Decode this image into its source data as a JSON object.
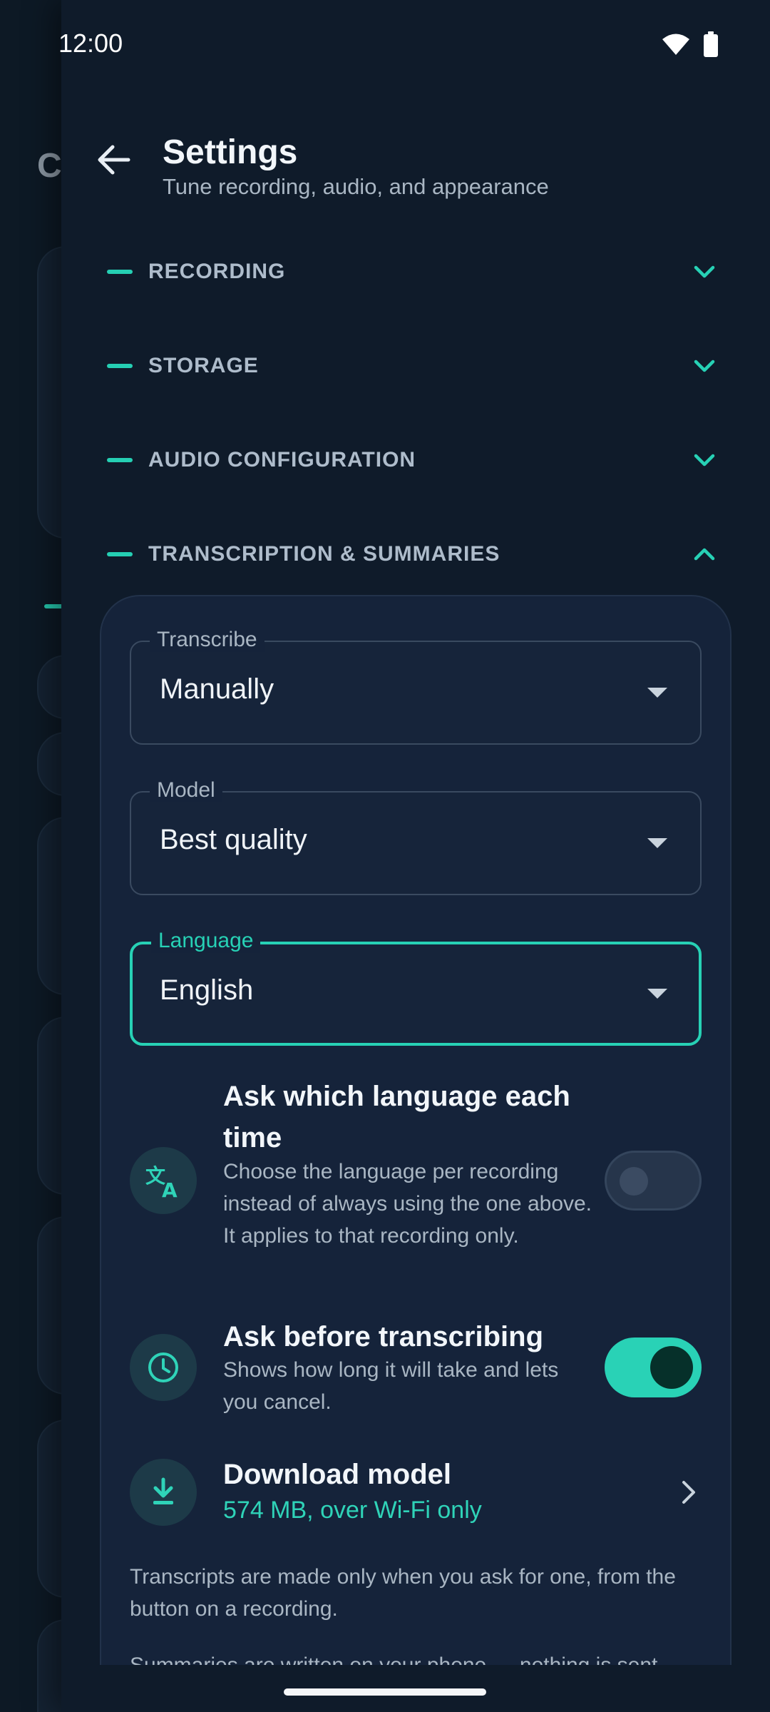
{
  "status_bar": {
    "time": "12:00",
    "icons": [
      "wifi-icon",
      "battery-icon"
    ]
  },
  "background": {
    "letter": "C"
  },
  "header": {
    "title": "Settings",
    "subtitle": "Tune recording, audio, and appearance"
  },
  "sections": [
    {
      "label": "RECORDING",
      "expanded": false
    },
    {
      "label": "STORAGE",
      "expanded": false
    },
    {
      "label": "AUDIO CONFIGURATION",
      "expanded": false
    },
    {
      "label": "TRANSCRIPTION & SUMMARIES",
      "expanded": true
    }
  ],
  "fields": {
    "transcribe": {
      "label": "Transcribe",
      "value": "Manually"
    },
    "model": {
      "label": "Model",
      "value": "Best quality"
    },
    "language": {
      "label": "Language",
      "value": "English"
    }
  },
  "rows": {
    "ask_language": {
      "title": "Ask which language each time",
      "description": "Choose the language per recording instead of always using the one above. It applies to that recording only.",
      "enabled": false,
      "icon": "translate-icon"
    },
    "ask_before": {
      "title": "Ask before transcribing",
      "description": "Shows how long it will take and lets you cancel.",
      "enabled": true,
      "icon": "clock-icon"
    },
    "download_model": {
      "title": "Download model",
      "detail": "574 MB, over Wi-Fi only",
      "icon": "download-icon"
    }
  },
  "footer": {
    "note1": "Transcripts are made only when you ask for one, from the button on a recording.",
    "note2": "Summaries are written on your phone — nothing is sent"
  },
  "colors": {
    "accent": "#27d1b5",
    "panel": "#0f1b2a",
    "card": "#15233a"
  }
}
